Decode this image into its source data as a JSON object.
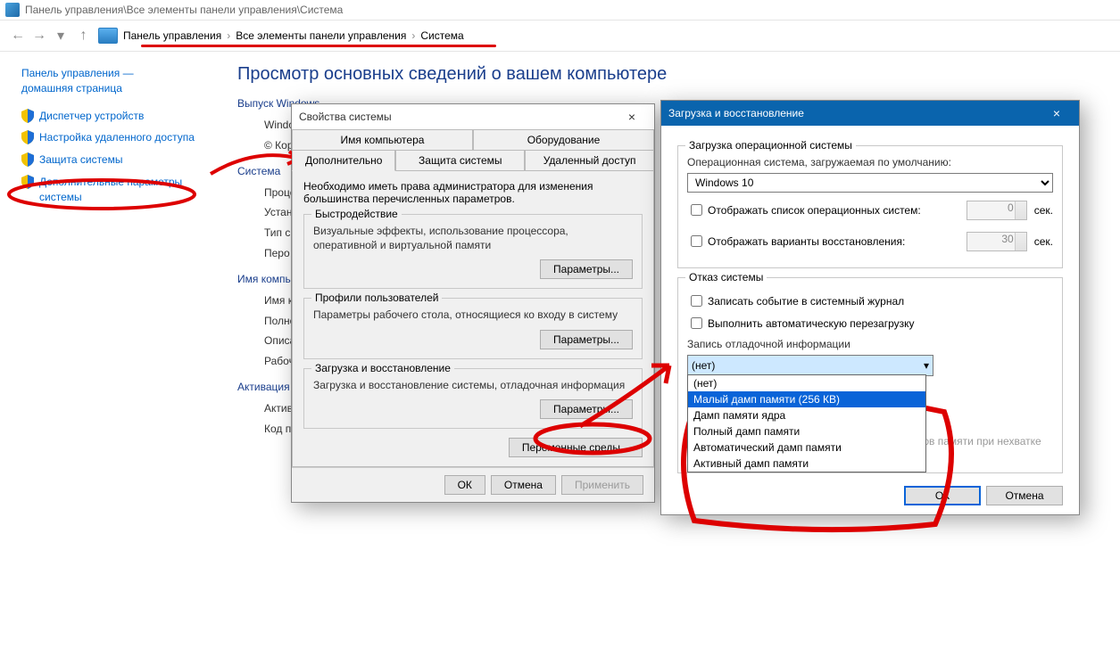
{
  "window": {
    "title_path": "Панель управления\\Все элементы панели управления\\Система"
  },
  "breadcrumb": {
    "items": [
      "Панель управления",
      "Все элементы панели управления",
      "Система"
    ]
  },
  "sidebar": {
    "home1": "Панель управления —",
    "home2": "домашняя страница",
    "links": [
      "Диспетчер устройств",
      "Настройка удаленного доступа",
      "Защита системы",
      "Дополнительные параметры системы"
    ]
  },
  "main": {
    "heading": "Просмотр основных сведений о вашем компьютере",
    "edition_title": "Выпуск Windows",
    "edition_line1": "Windows 10",
    "edition_line2": "© Корпорация",
    "system_title": "Система",
    "sys_rows": [
      "Процессор:",
      "Установленная память (ОЗУ):",
      "Тип системы:",
      "Перо и сенсорный ввод:"
    ],
    "name_title": "Имя компьютера",
    "name_rows": [
      "Имя компьютера:",
      "Полное имя:",
      "Описание:",
      "Рабочая группа:"
    ],
    "act_title": "Активация Windows",
    "act_rows": [
      "Активация Windows",
      "Код продукта:"
    ]
  },
  "sysprops": {
    "title": "Свойства системы",
    "tabs_top": [
      "Имя компьютера",
      "Оборудование"
    ],
    "tabs_bottom": [
      "Дополнительно",
      "Защита системы",
      "Удаленный доступ"
    ],
    "note": "Необходимо иметь права администратора для изменения большинства перечисленных параметров.",
    "perf_title": "Быстродействие",
    "perf_text": "Визуальные эффекты, использование процессора, оперативной и виртуальной памяти",
    "profiles_title": "Профили пользователей",
    "profiles_text": "Параметры рабочего стола, относящиеся ко входу в систему",
    "startup_title": "Загрузка и восстановление",
    "startup_text": "Загрузка и восстановление системы, отладочная информация",
    "params_btn": "Параметры...",
    "envvars_btn": "Переменные среды...",
    "ok": "ОК",
    "cancel": "Отмена",
    "apply": "Применить"
  },
  "startup": {
    "title": "Загрузка и восстановление",
    "boot_title": "Загрузка операционной системы",
    "default_os_label": "Операционная система, загружаемая по умолчанию:",
    "default_os": "Windows 10",
    "show_list": "Отображать список операционных систем:",
    "show_list_sec": "0",
    "sec_label": "сек.",
    "show_recovery": "Отображать варианты восстановления:",
    "show_recovery_sec": "30",
    "fail_title": "Отказ системы",
    "write_event": "Записать событие в системный журнал",
    "auto_restart": "Выполнить автоматическую перезагрузку",
    "dump_label": "Запись отладочной информации",
    "dump_selected": "(нет)",
    "dump_options": [
      "(нет)",
      "Малый дамп памяти (256 КВ)",
      "Дамп памяти ядра",
      "Полный дамп памяти",
      "Автоматический дамп памяти",
      "Активный дамп памяти"
    ],
    "disable_auto_delete": "Отключить автоматическое удаление дампов памяти при нехватке места на диске",
    "ok": "ОК",
    "cancel": "Отмена"
  }
}
